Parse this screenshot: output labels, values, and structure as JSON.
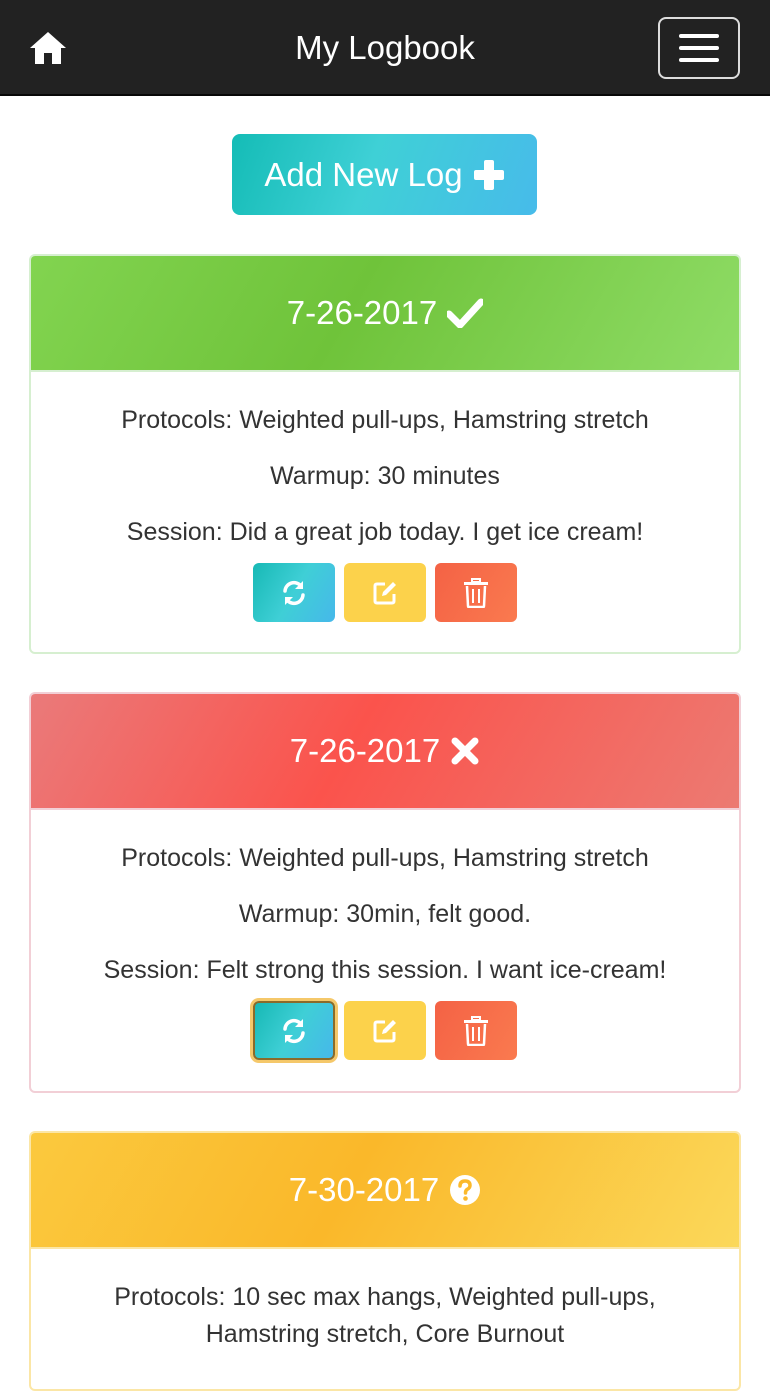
{
  "navbar": {
    "title": "My Logbook",
    "home_icon": "home-icon",
    "menu_icon": "hamburger-menu-icon"
  },
  "add_button": {
    "label": "Add New Log",
    "icon": "plus-icon"
  },
  "logs": [
    {
      "date": "7-26-2017",
      "status": "complete",
      "status_icon": "check-icon",
      "color": "#77c94a",
      "protocols": "Protocols: Weighted pull-ups, Hamstring stretch",
      "warmup": "Warmup: 30 minutes",
      "session": "Session: Did a great job today. I get ice cream!"
    },
    {
      "date": "7-26-2017",
      "status": "failed",
      "status_icon": "x-icon",
      "color": "#f65a54",
      "protocols": "Protocols: Weighted pull-ups, Hamstring stretch",
      "warmup": "Warmup: 30min, felt good.",
      "session": "Session: Felt strong this session. I want ice-cream!"
    },
    {
      "date": "7-30-2017",
      "status": "unknown",
      "status_icon": "question-circle-icon",
      "color": "#fbc13a",
      "protocols_line1": "Protocols: 10 sec max hangs, Weighted pull-ups,",
      "protocols_line2": "Hamstring stretch, Core Burnout"
    }
  ],
  "actions": {
    "refresh_icon": "refresh-icon",
    "edit_icon": "edit-icon",
    "delete_icon": "trash-icon"
  },
  "colors": {
    "navbar": "#222222",
    "accent_teal": "#3fcfd6",
    "edit_yellow": "#fcd24b",
    "delete_red": "#f46245"
  }
}
